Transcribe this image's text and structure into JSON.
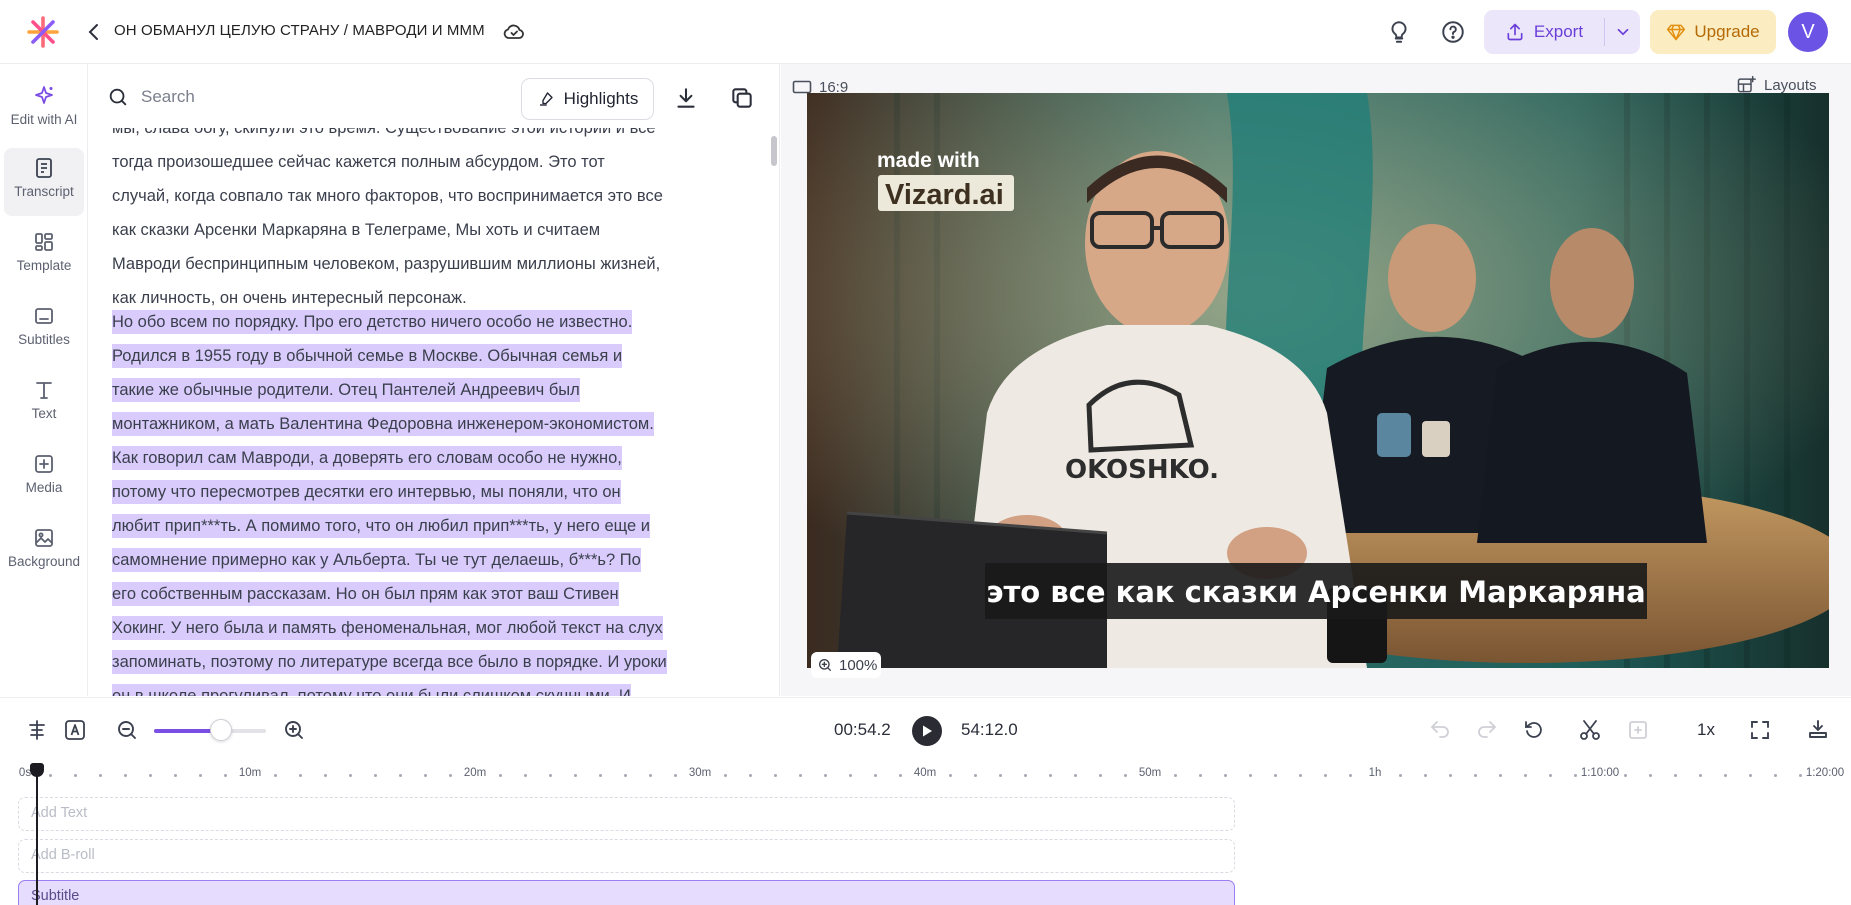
{
  "header": {
    "project_title": "ОН ОБМАНУЛ ЦЕЛУЮ СТРАНУ / МАВРОДИ И МММ",
    "export_label": "Export",
    "upgrade_label": "Upgrade",
    "avatar_initial": "V",
    "colors": {
      "accent": "#6a3fd8",
      "upgrade": "#b56a06",
      "avatar": "#6b53e6"
    }
  },
  "sidebar": {
    "items": [
      {
        "label": "Edit with AI",
        "icon": "sparkle-icon"
      },
      {
        "label": "Transcript",
        "icon": "transcript-icon",
        "active": true
      },
      {
        "label": "Template",
        "icon": "template-icon"
      },
      {
        "label": "Subtitles",
        "icon": "subtitles-icon"
      },
      {
        "label": "Text",
        "icon": "text-icon"
      },
      {
        "label": "Media",
        "icon": "media-icon"
      },
      {
        "label": "Background",
        "icon": "background-icon"
      }
    ]
  },
  "transcript": {
    "search_placeholder": "Search",
    "highlights_label": "Highlights",
    "paragraphs": [
      {
        "text": "мы, слава богу, скинули это время. Существование этой истории и все тогда произошедшее сейчас кажется полным абсурдом. Это тот случай, когда совпало так много факторов, что воспринимается это все как сказки Арсенки Маркаряна в Телеграме, Мы хоть и считаем Мавроди беспринципным человеком, разрушившим миллионы жизней, как личность, он очень интересный персонаж.",
        "highlighted": false
      },
      {
        "text": "Но обо всем по порядку. Про его детство ничего особо не известно. Родился в 1955 году в обычной семье в Москве. Обычная семья и такие же обычные родители. Отец Пантелей Андреевич был монтажником, а мать Валентина Федоровна инженером-экономистом. Как говорил сам Мавроди, а доверять его словам особо не нужно, потому что пересмотрев десятки его интервью, мы поняли, что он любит прип***ть. А помимо того, что он любил прип***ть, у него еще и самомнение примерно как у Альберта. Ты че тут делаешь, б***ь? По его собственным рассказам. Но он был прям как этот ваш Стивен Хокинг. У него была и память феноменальная, мог любой текст на слух запоминать, поэтому по литературе всегда все было в порядке. И уроки он в школе прогуливал, потому что они были слишком скучными. И любые задания по математике и физике он решал на раз-два, даже в олимпиадах все время побеждал. В общем, я в своем",
        "highlighted": true
      }
    ]
  },
  "preview": {
    "aspect_ratio": "16:9",
    "layouts_label": "Layouts",
    "watermark_line1": "made with",
    "watermark_line2": "Vizard.ai",
    "caption": "это все как сказки Арсенки  Маркаряна",
    "shirt_brand": "OKOSHKO.",
    "zoom": "100%"
  },
  "controls": {
    "current_time": "00:54.2",
    "total_time": "54:12.0",
    "speed": "1x",
    "zoom_level": 0.6
  },
  "timeline": {
    "ruler_labels": [
      "0s",
      "10m",
      "20m",
      "30m",
      "40m",
      "50m",
      "1h",
      "1:10:00",
      "1:20:00"
    ],
    "tracks": [
      {
        "label": "Add Text",
        "kind": "placeholder"
      },
      {
        "label": "Add B-roll",
        "kind": "placeholder"
      },
      {
        "label": "Subtitle",
        "kind": "subtitle"
      }
    ]
  }
}
